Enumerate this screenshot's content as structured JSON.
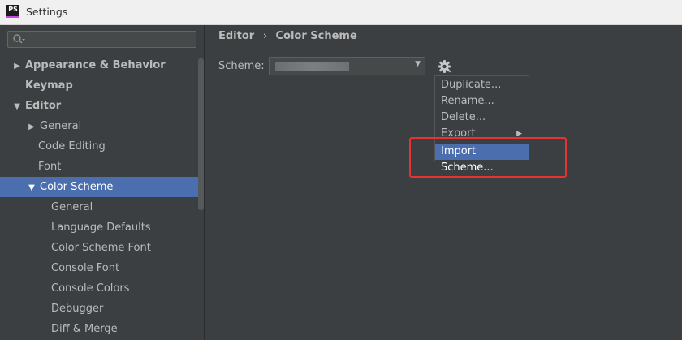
{
  "window": {
    "title": "Settings",
    "icon_text": "PS"
  },
  "search": {
    "placeholder": ""
  },
  "tree": [
    {
      "label": "Appearance & Behavior",
      "arrow": "▶",
      "bold": true,
      "indent": 0
    },
    {
      "label": "Keymap",
      "arrow": "",
      "bold": true,
      "indent": 0
    },
    {
      "label": "Editor",
      "arrow": "▼",
      "bold": true,
      "indent": 0
    },
    {
      "label": "General",
      "arrow": "▶",
      "bold": false,
      "indent": 1
    },
    {
      "label": "Code Editing",
      "arrow": "",
      "bold": false,
      "indent": 1
    },
    {
      "label": "Font",
      "arrow": "",
      "bold": false,
      "indent": 1
    },
    {
      "label": "Color Scheme",
      "arrow": "▼",
      "bold": false,
      "indent": 1,
      "selected": true
    },
    {
      "label": "General",
      "arrow": "",
      "bold": false,
      "indent": 2
    },
    {
      "label": "Language Defaults",
      "arrow": "",
      "bold": false,
      "indent": 2
    },
    {
      "label": "Color Scheme Font",
      "arrow": "",
      "bold": false,
      "indent": 2
    },
    {
      "label": "Console Font",
      "arrow": "",
      "bold": false,
      "indent": 2
    },
    {
      "label": "Console Colors",
      "arrow": "",
      "bold": false,
      "indent": 2
    },
    {
      "label": "Debugger",
      "arrow": "",
      "bold": false,
      "indent": 2
    },
    {
      "label": "Diff & Merge",
      "arrow": "",
      "bold": false,
      "indent": 2
    }
  ],
  "breadcrumb": {
    "parent": "Editor",
    "separator": "›",
    "current": "Color Scheme"
  },
  "scheme": {
    "label": "Scheme:",
    "value": ""
  },
  "gear_menu": {
    "items": [
      {
        "label": "Duplicate...",
        "submenu": false,
        "highlighted": false
      },
      {
        "label": "Rename...",
        "submenu": false,
        "highlighted": false
      },
      {
        "label": "Delete...",
        "submenu": false,
        "highlighted": false
      },
      {
        "label": "Export",
        "submenu": true,
        "highlighted": false
      },
      {
        "label": "Import Scheme...",
        "submenu": false,
        "highlighted": true
      }
    ]
  },
  "colors": {
    "accent": "#4b6eaf",
    "background": "#3c3f41",
    "annotation": "#e53333"
  },
  "icons": {
    "search": "search-icon",
    "gear": "gear-icon",
    "combo": "chevron-down-icon"
  }
}
